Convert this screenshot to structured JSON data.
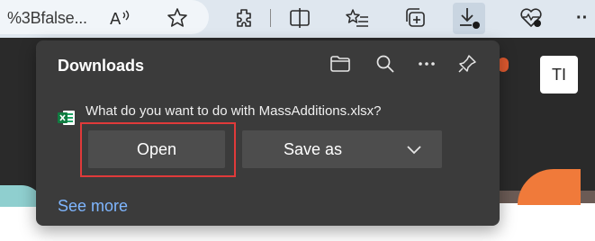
{
  "toolbar": {
    "address_fragment": "%3Bfalse...",
    "icons": [
      "read-aloud-icon",
      "favorite-star-icon",
      "extensions-icon",
      "split-screen-icon",
      "favorites-list-icon",
      "collections-icon",
      "downloads-icon",
      "browser-essentials-icon",
      "more-icon"
    ],
    "more_label": "··"
  },
  "page": {
    "avatar_initials": "TI"
  },
  "downloads": {
    "title": "Downloads",
    "question": "What do you want to do with MassAdditions.xlsx?",
    "open_label": "Open",
    "save_as_label": "Save as",
    "see_more_label": "See more"
  },
  "colors": {
    "panel_bg": "#3b3b3b",
    "button_bg": "#4d4d4d",
    "highlight": "#e03a3a",
    "link": "#7fb6ff",
    "toolbar_bg": "#dfe7ef"
  }
}
